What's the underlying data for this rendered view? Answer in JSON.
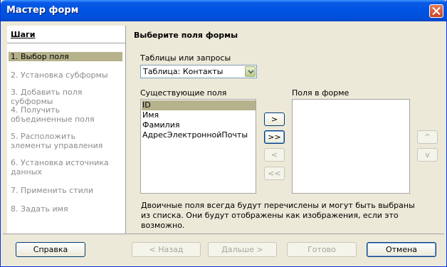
{
  "window": {
    "title": "Мастер форм"
  },
  "steps": {
    "title": "Шаги",
    "items": [
      {
        "label": "1. Выбор поля",
        "active": true
      },
      {
        "label": "2. Установка субформы",
        "active": false
      },
      {
        "label": "3. Добавить поля субформы",
        "active": false
      },
      {
        "label": "4. Получить объединенные поля",
        "active": false
      },
      {
        "label": "5. Расположить элементы управления",
        "active": false
      },
      {
        "label": "6. Установка источника данных",
        "active": false
      },
      {
        "label": "7. Применить стили",
        "active": false
      },
      {
        "label": "8. Задать имя",
        "active": false
      }
    ]
  },
  "main": {
    "title": "Выберите поля формы",
    "tables_label": "Таблицы или запросы",
    "tables_value": "Таблица: Контакты",
    "existing_label": "Существующие поля",
    "existing_fields": [
      "ID",
      "Имя",
      "Фамилия",
      "АдресЭлектроннойПочты"
    ],
    "selected_field": "ID",
    "form_fields_label": "Поля в форме",
    "form_fields": [],
    "move_buttons": {
      "add": ">",
      "add_all": ">>",
      "remove": "<",
      "remove_all": "<<"
    },
    "order_buttons": {
      "up": "^",
      "down": "v"
    },
    "note": "Двоичные поля всегда будут перечислены и могут быть выбраны из списка. Они будут отображены как изображения, если это возможно."
  },
  "footer": {
    "help": "Справка",
    "back": "< Назад",
    "next": "Дальше >",
    "finish": "Готово",
    "cancel": "Отмена"
  },
  "colors": {
    "titlebar": "#0054e3",
    "selection": "#b5b28c",
    "dialog_bg": "#ece9d8"
  }
}
